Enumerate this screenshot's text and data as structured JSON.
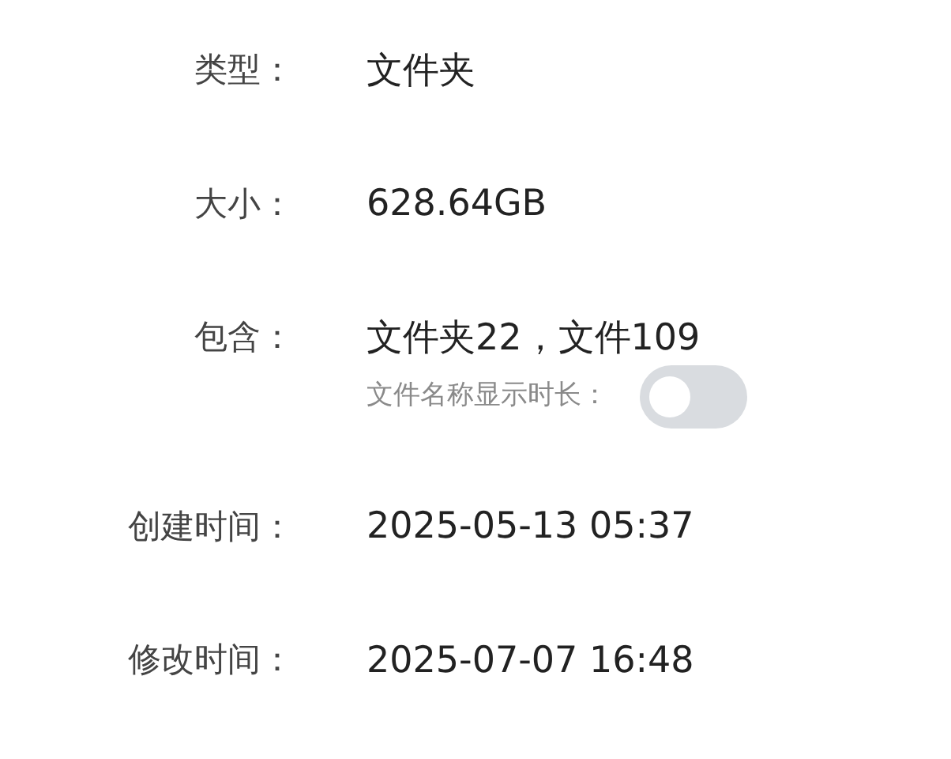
{
  "rows": [
    {
      "kind": "text",
      "label": "类型：",
      "value": "文件夹"
    },
    {
      "kind": "text",
      "label": "大小：",
      "value": "628.64GB"
    },
    {
      "kind": "text",
      "label": "包含：",
      "value": "文件夹22，文件109"
    },
    {
      "kind": "toggle",
      "label": "文件名称显示时长：",
      "on": false
    },
    {
      "kind": "text",
      "label": "创建时间：",
      "value": "2025-05-13 05:37"
    },
    {
      "kind": "text",
      "label": "修改时间：",
      "value": "2025-07-07 16:48"
    }
  ]
}
